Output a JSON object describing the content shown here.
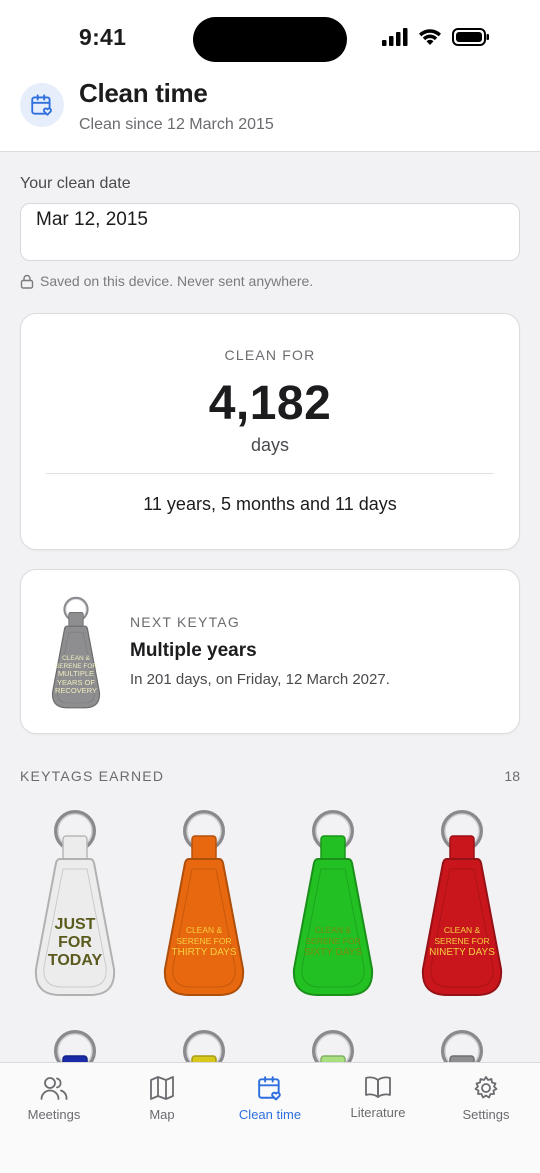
{
  "status_bar": {
    "time": "9:41"
  },
  "header": {
    "title": "Clean time",
    "subtitle": "Clean since 12 March 2015",
    "icon": "calendar-heart-icon"
  },
  "clean_date": {
    "label": "Your clean date",
    "value": "Mar 12, 2015",
    "saved_note": "Saved on this device. Never sent anywhere."
  },
  "clean_card": {
    "label": "CLEAN FOR",
    "count": "4,182",
    "unit": "days",
    "duration": "11 years, 5 months and 11 days"
  },
  "next_keytag": {
    "label": "NEXT KEYTAG",
    "title": "Multiple years",
    "when": "In 201 days, on Friday, 12 March 2027.",
    "tag_lines": [
      "CLEAN &",
      "SERENE FOR",
      "MULTIPLE",
      "YEARS OF",
      "RECOVERY"
    ],
    "tag_color": "#8e8e90"
  },
  "keytags_earned": {
    "label": "KEYTAGS EARNED",
    "count": "18",
    "tags": [
      {
        "lines": [
          "JUST",
          "FOR",
          "TODAY"
        ],
        "color": "#ececec",
        "text_color": "#5a5a1e"
      },
      {
        "lines": [
          "CLEAN &",
          "SERENE FOR",
          "THIRTY DAYS"
        ],
        "color": "#e8680f",
        "text_color": "#f4d040"
      },
      {
        "lines": [
          "CLEAN &",
          "SERENE FOR",
          "SIXTY DAYS"
        ],
        "color": "#22c022",
        "text_color": "#7a8a10"
      },
      {
        "lines": [
          "CLEAN &",
          "SERENE FOR",
          "NINETY DAYS"
        ],
        "color": "#c8161c",
        "text_color": "#f4d040"
      }
    ],
    "next_row_colors": [
      "#1a2aa8",
      "#d8c81a",
      "#a8e080",
      "#8e8e90"
    ]
  },
  "tab_bar": {
    "tabs": [
      {
        "label": "Meetings",
        "icon": "people-icon"
      },
      {
        "label": "Map",
        "icon": "map-icon"
      },
      {
        "label": "Clean time",
        "icon": "calendar-heart-icon"
      },
      {
        "label": "Literature",
        "icon": "book-icon"
      },
      {
        "label": "Settings",
        "icon": "gear-icon"
      }
    ],
    "active": "Clean time"
  },
  "colors": {
    "accent": "#2f6fde"
  }
}
